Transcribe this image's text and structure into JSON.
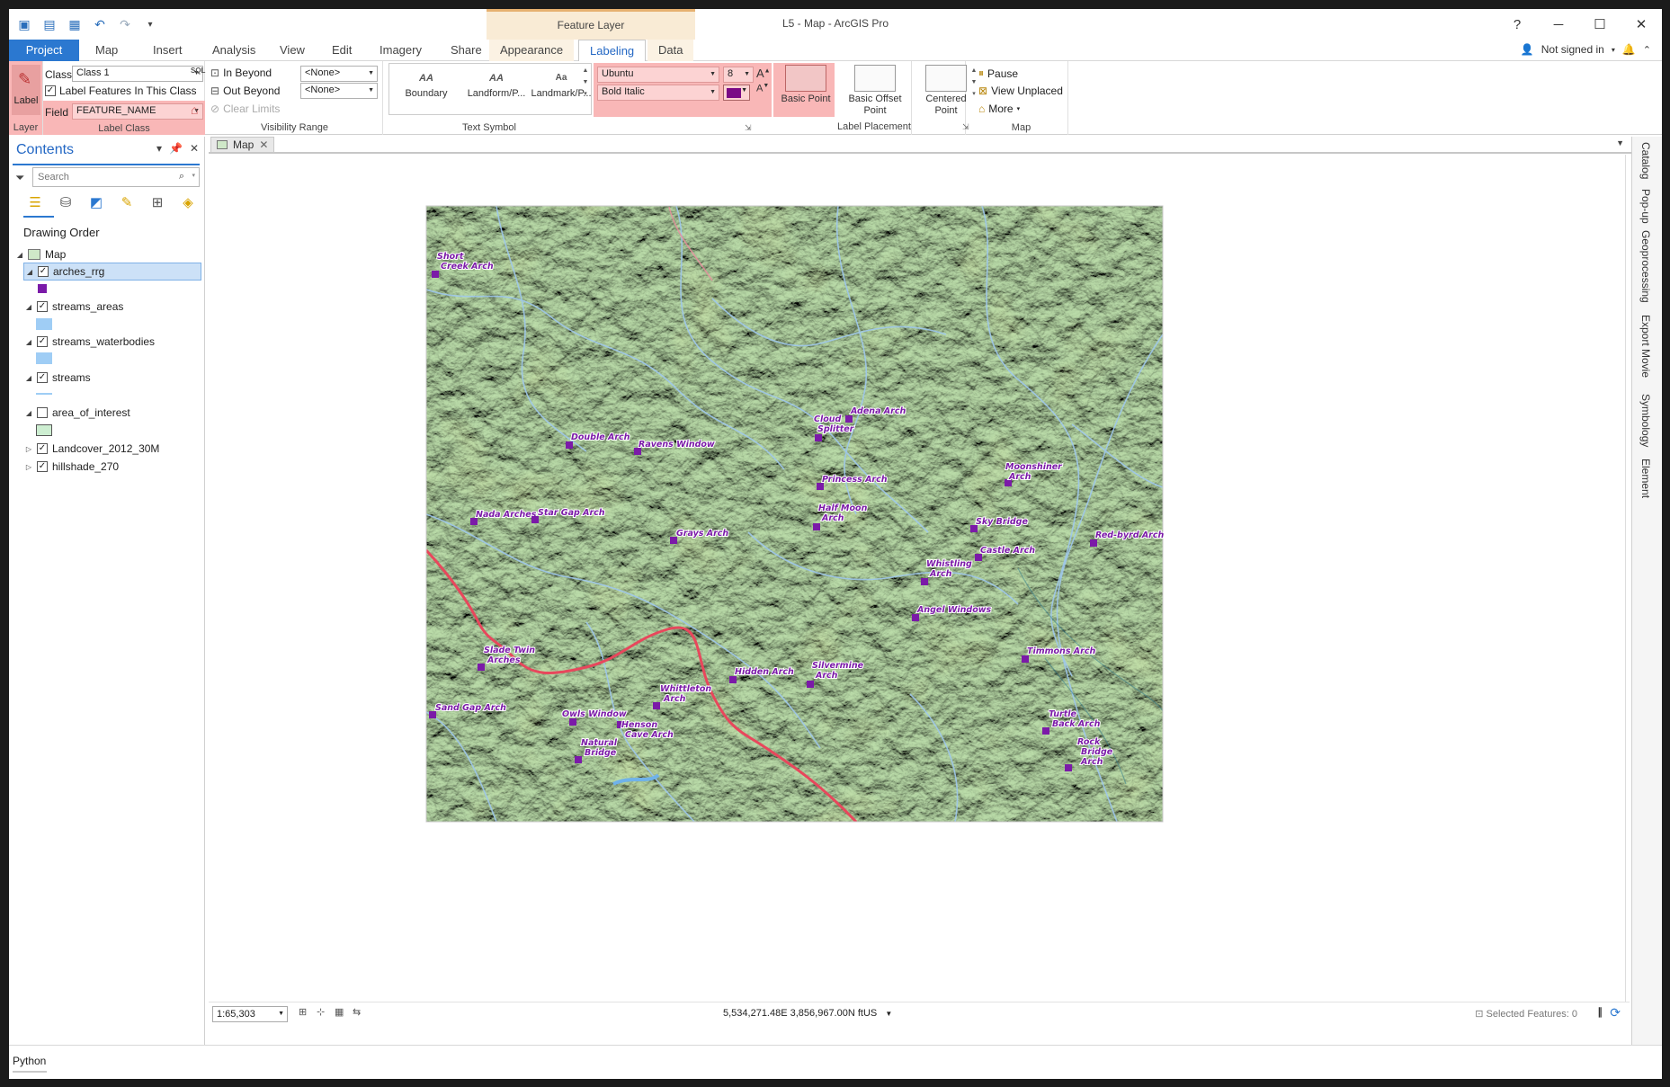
{
  "titlebar": {
    "context_tab_header": "Feature Layer",
    "window_title": "L5 - Map - ArcGIS Pro",
    "help": "?",
    "minimize": "─",
    "maximize": "☐",
    "close": "✕"
  },
  "tabs": [
    "Project",
    "Map",
    "Insert",
    "Analysis",
    "View",
    "Edit",
    "Imagery",
    "Share",
    "Appearance",
    "Labeling",
    "Data"
  ],
  "active_tab": "Labeling",
  "signin": {
    "label": "Not signed in"
  },
  "ribbon": {
    "layer": {
      "button_label": "Label",
      "group_label": "Layer"
    },
    "label_class": {
      "class_label": "Class",
      "class_value": "Class 1",
      "label_features_checkbox": "Label Features In This Class",
      "field_label": "Field",
      "field_value": "FEATURE_NAME",
      "group_label": "Label Class"
    },
    "visibility_range": {
      "in_beyond": "In Beyond",
      "out_beyond": "Out Beyond",
      "clear_limits": "Clear Limits",
      "in_value": "<None>",
      "out_value": "<None>",
      "group_label": "Visibility Range"
    },
    "text_symbol": {
      "gallery": [
        "Boundary",
        "Landform/P...",
        "Landmark/P..."
      ],
      "gallery_glyphs": [
        "AA",
        "AA",
        "Aa"
      ],
      "font_name": "Ubuntu",
      "font_style": "Bold Italic",
      "font_size": "8",
      "font_color": "#7b0a86",
      "group_label": "Text Symbol"
    },
    "label_placement": {
      "items": [
        "Basic Point",
        "Basic Offset Point",
        "Centered Point"
      ],
      "group_label": "Label Placement"
    },
    "map": {
      "pause": "Pause",
      "view_unplaced": "View Unplaced",
      "more": "More",
      "group_label": "Map"
    }
  },
  "contents": {
    "title": "Contents",
    "search_placeholder": "Search",
    "drawing_order": "Drawing Order",
    "map_node": "Map",
    "layers": [
      {
        "name": "arches_rrg",
        "checked": true,
        "selected": true
      },
      {
        "name": "streams_areas",
        "checked": true
      },
      {
        "name": "streams_waterbodies",
        "checked": true
      },
      {
        "name": "streams",
        "checked": true
      },
      {
        "name": "area_of_interest",
        "checked": false
      },
      {
        "name": "Landcover_2012_30M",
        "checked": true
      },
      {
        "name": "hillshade_270",
        "checked": true
      }
    ],
    "symbol_colors": {
      "arches": "#7b1aa8",
      "water": "#9fcdf5",
      "aoi": "#cdeed1"
    }
  },
  "map": {
    "tab_label": "Map",
    "scale": "1:65,303",
    "coordinates": "5,534,271.48E 3,856,967.00N ftUS",
    "selected_features": "Selected Features: 0",
    "labels": [
      "Short Creek Arch",
      "Double Arch",
      "Ravens Window",
      "Cloud Splitter",
      "Adena Arch",
      "Princess Arch",
      "Moonshiner Arch",
      "Nada Arches",
      "Star Gap Arch",
      "Grays Arch",
      "Half Moon Arch",
      "Sky Bridge",
      "Red-byrd Arch",
      "Castle Arch",
      "Whistling Arch",
      "Angel Windows",
      "Slade Twin Arches",
      "Timmons Arch",
      "Hidden Arch",
      "Silvermine Arch",
      "Whittleton Arch",
      "Sand Gap Arch",
      "Owls Window",
      "Henson Cave Arch",
      "Turtle Back Arch",
      "Rock Bridge Arch",
      "Natural Bridge"
    ]
  },
  "right_rail": [
    "Catalog",
    "Pop-up",
    "Geoprocessing",
    "Export Movie",
    "Symbology",
    "Element"
  ],
  "bottom": {
    "python_tab": "Python"
  },
  "colors": {
    "accent": "#2b78d0",
    "highlight": "#f9b7b7",
    "context_tab": "#f9ebd5"
  }
}
